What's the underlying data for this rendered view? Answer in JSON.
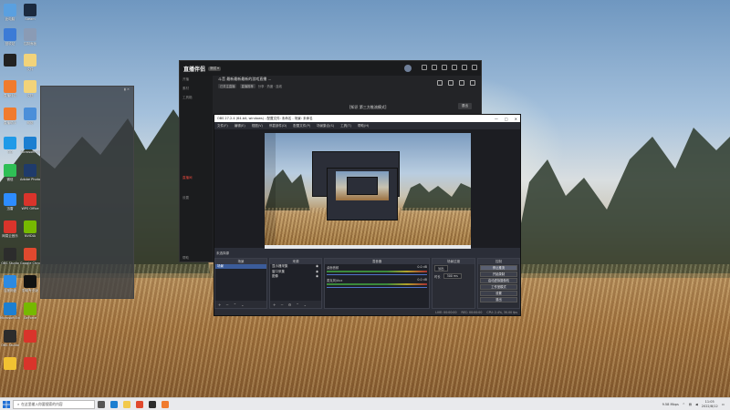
{
  "desktop": {
    "icons": [
      {
        "label": "此电脑",
        "color": "#5aa0e0"
      },
      {
        "label": "Steam",
        "color": "#1b2a3f"
      },
      {
        "label": "回收站",
        "color": "#3c7bd6"
      },
      {
        "label": "控制面板",
        "color": "#8a9bb5"
      },
      {
        "label": "",
        "color": "#222222"
      },
      {
        "label": "文件",
        "color": "#f2d37a"
      },
      {
        "label": "直播伴侣",
        "color": "#f07b2e"
      },
      {
        "label": "文档",
        "color": "#f2d37a"
      },
      {
        "label": "直播助手",
        "color": "#f07b2e"
      },
      {
        "label": "网络",
        "color": "#4b8fd9"
      },
      {
        "label": "QQ",
        "color": "#1f9ae8"
      },
      {
        "label": "Microsoft Edge",
        "color": "#1c7fd1"
      },
      {
        "label": "微信",
        "color": "#2fbf55"
      },
      {
        "label": "Adobe Photoshop",
        "color": "#1f3b6b"
      },
      {
        "label": "迅雷",
        "color": "#2d8cff"
      },
      {
        "label": "WPS Office",
        "color": "#d9342b"
      },
      {
        "label": "网易云音乐",
        "color": "#d9342b"
      },
      {
        "label": "NVIDIA",
        "color": "#76b900"
      },
      {
        "label": "OBS Studio",
        "color": "#2c2c2c"
      },
      {
        "label": "Google Chrome",
        "color": "#e0492e"
      },
      {
        "label": "百度网盘",
        "color": "#2b8ae2"
      },
      {
        "label": "剪映专业版",
        "color": "#111111"
      },
      {
        "label": "Microsoft Edge",
        "color": "#1c7fd1"
      },
      {
        "label": "GeForce",
        "color": "#76b900"
      },
      {
        "label": "OBS Studio",
        "color": "#2c2c2c"
      },
      {
        "label": "",
        "color": "#d9342b"
      },
      {
        "label": "",
        "color": "#f1c232"
      },
      {
        "label": "",
        "color": "#d9342b"
      }
    ]
  },
  "ghost_window": {
    "title": "",
    "controls": "▮ ✕"
  },
  "live_app": {
    "logo": "直播伴侣",
    "badge": "测试 ▾",
    "room_title": "斗音 最新最新最新的游戏直播 ...",
    "room_chips": [
      "已关注直播",
      "直播推荐"
    ],
    "room_meta": "分享 · 热度 · 连线",
    "mode_text": "[知识 第三方推流模式]",
    "mode_button": "退出",
    "sidebar": [
      {
        "label": "开播",
        "active": false
      },
      {
        "label": "素材",
        "active": false
      },
      {
        "label": "工具箱",
        "active": false
      },
      {
        "label": "直播间",
        "active": true
      },
      {
        "label": "设置",
        "active": false
      },
      {
        "label": "帮助",
        "active": false
      }
    ]
  },
  "obs": {
    "title": "OBS 27.2.4 (64-bit, windows) - 配置文件: 未命名 - 场景: 未命名",
    "menu": [
      "文件(F)",
      "编辑(E)",
      "视图(V)",
      "停靠部件(D)",
      "配置文件(P)",
      "场景集合(S)",
      "工具(T)",
      "帮助(H)"
    ],
    "preview_label": "未选择源",
    "scene_dock": {
      "title": "场景",
      "items": [
        "场景"
      ]
    },
    "sources_dock": {
      "title": "来源",
      "items": [
        "显示器采集",
        "窗口采集",
        "图像"
      ]
    },
    "mixer_dock": {
      "title": "混音器",
      "channels": [
        {
          "name": "桌面音频",
          "level": "0.0 dB"
        },
        {
          "name": "麦克风/Aux",
          "level": "0.0 dB"
        }
      ]
    },
    "transitions_dock": {
      "title": "场景过渡",
      "type": "淡出",
      "duration_label": "时长",
      "duration": "300 ms"
    },
    "controls_dock": {
      "title": "控制",
      "buttons": [
        "停止推流",
        "开始录制",
        "启动虚拟摄像机",
        "工作室模式",
        "设置",
        "退出"
      ]
    },
    "status": [
      "LIVE: 00:00:00",
      "REC: 00:00:00",
      "CPU: 2.4%, 30.00 fps"
    ]
  },
  "taskbar": {
    "search_placeholder": "在这里输入你要搜索的内容",
    "apps": [
      {
        "name": "task-view",
        "color": "#555555"
      },
      {
        "name": "edge",
        "color": "#1c7fd1"
      },
      {
        "name": "file-explorer",
        "color": "#f2c94c"
      },
      {
        "name": "chrome",
        "color": "#e0492e"
      },
      {
        "name": "obs",
        "color": "#2c2c2c"
      },
      {
        "name": "live-app",
        "color": "#f07b2e"
      }
    ],
    "tray_text": "9.58 Mbps",
    "time": "11:05",
    "date": "2022/8/12"
  }
}
